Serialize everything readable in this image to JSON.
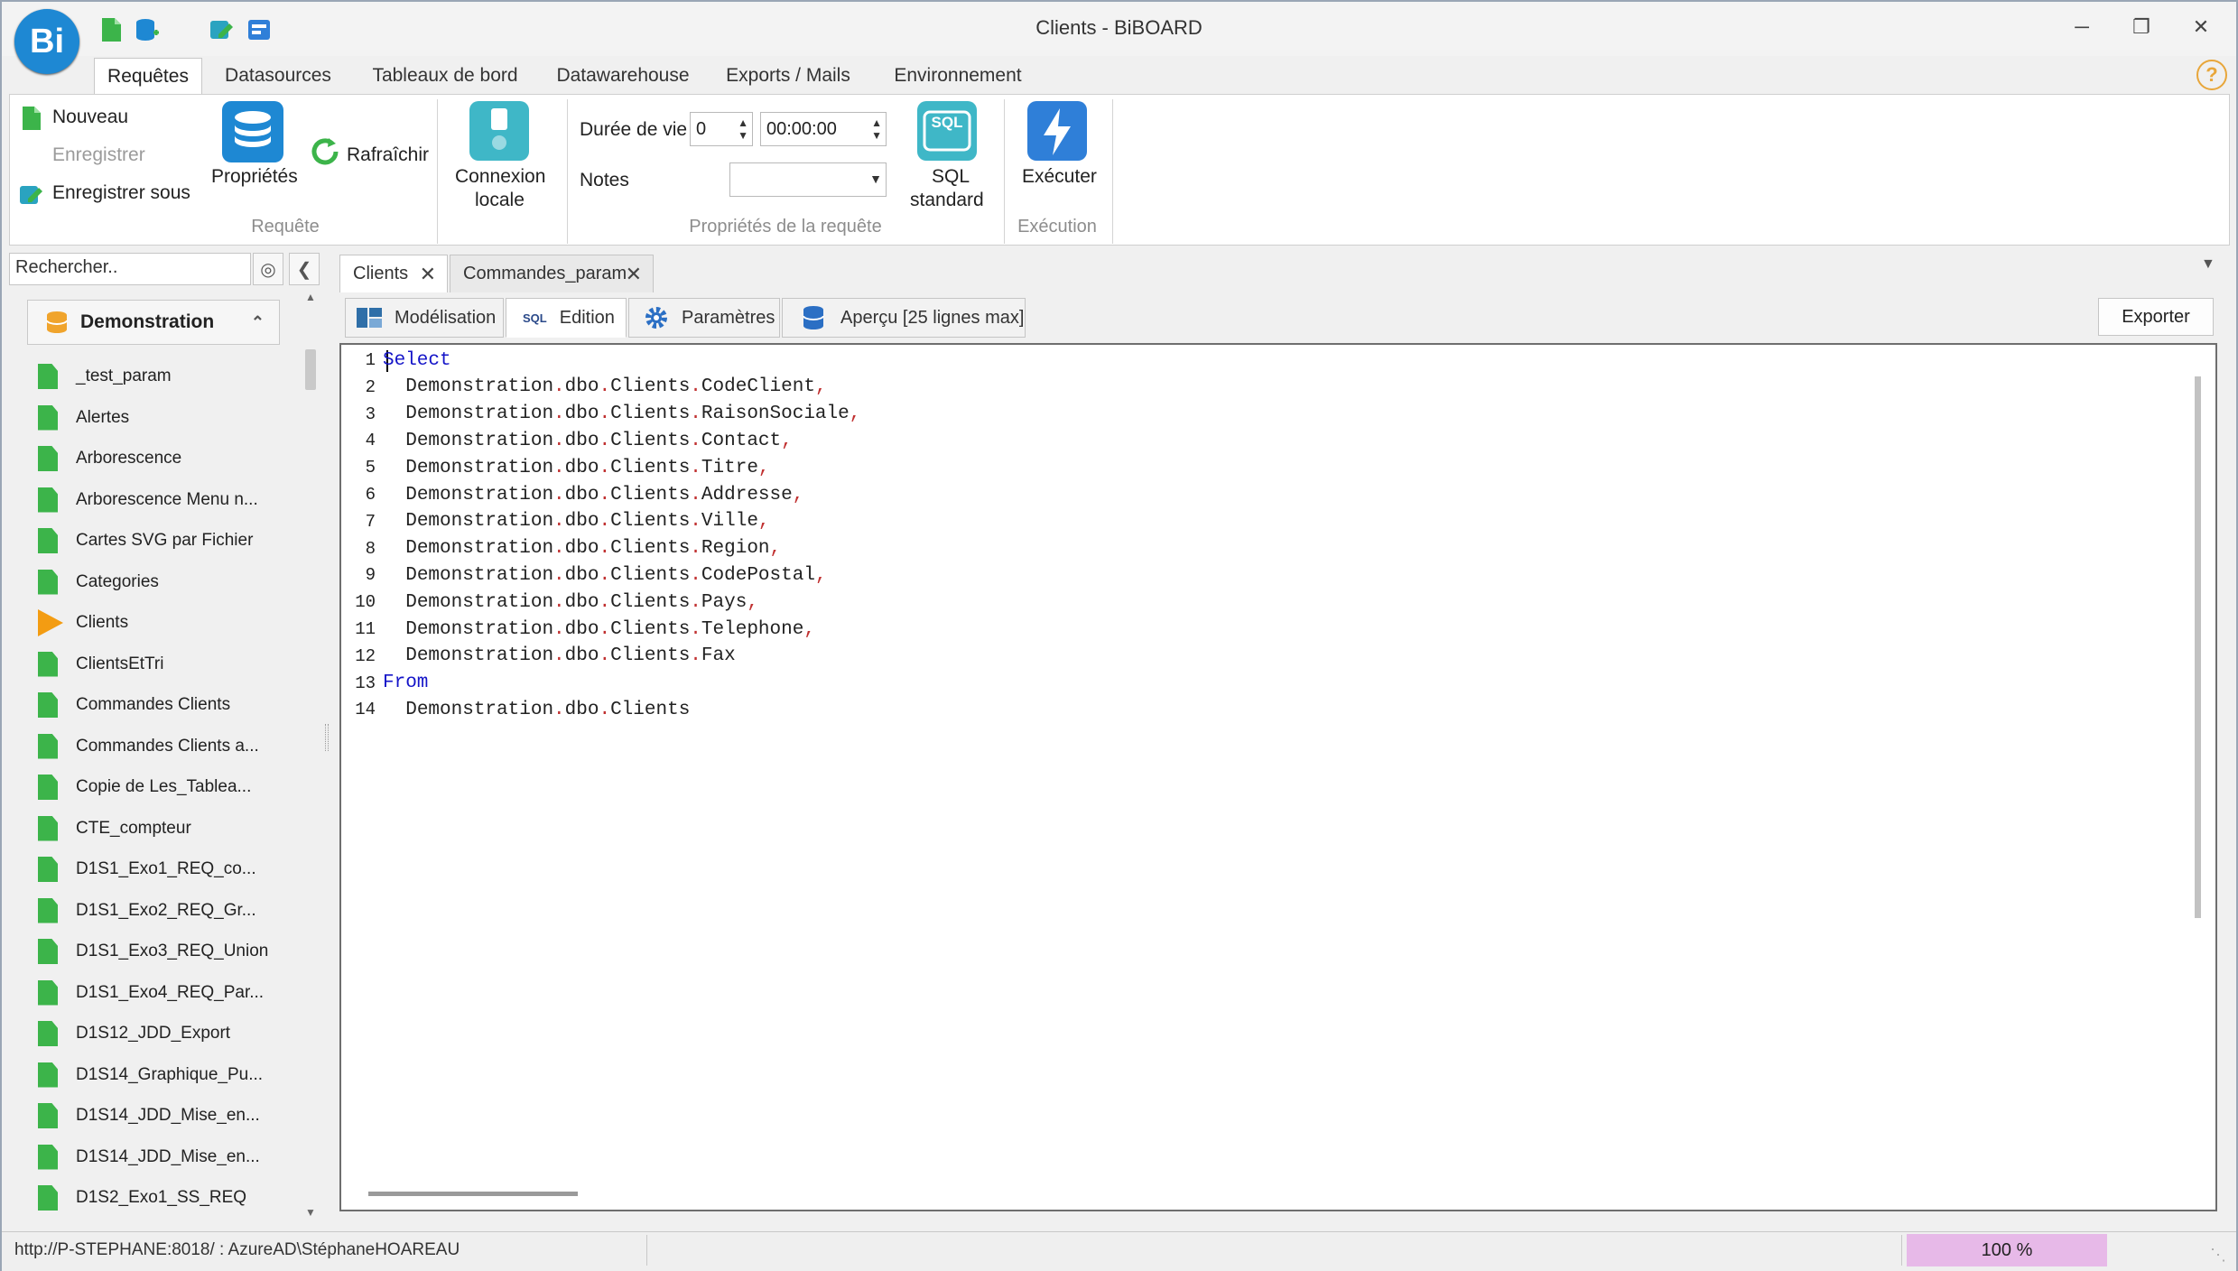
{
  "window": {
    "title": "Clients - BiBOARD",
    "logo_text": "Bi"
  },
  "menu_tabs": [
    "Requêtes",
    "Datasources",
    "Tableaux de bord",
    "Datawarehouse",
    "Exports / Mails",
    "Environnement"
  ],
  "ribbon": {
    "nouveau": "Nouveau",
    "enregistrer": "Enregistrer",
    "enregistrer_sous": "Enregistrer sous",
    "proprietes": "Propriétés",
    "rafraichir": "Rafraîchir",
    "connexion_line1": "Connexion",
    "connexion_line2": "locale",
    "group_requete": "Requête",
    "duree_label": "Durée de vie",
    "duree_value": "0",
    "duree_time": "00:00:00",
    "notes_label": "Notes",
    "sql_badge": "SQL",
    "sql_line1": "SQL",
    "sql_line2": "standard",
    "group_proprietes": "Propriétés de la requête",
    "executer": "Exécuter",
    "group_execution": "Exécution"
  },
  "sidebar": {
    "search_placeholder": "Rechercher..",
    "datasource": "Demonstration",
    "items": [
      {
        "label": "_test_param",
        "icon": "file-icon"
      },
      {
        "label": "Alertes",
        "icon": "file-icon"
      },
      {
        "label": "Arborescence",
        "icon": "file-icon"
      },
      {
        "label": "Arborescence Menu n...",
        "icon": "file-icon"
      },
      {
        "label": "Cartes SVG par Fichier",
        "icon": "file-icon"
      },
      {
        "label": "Categories",
        "icon": "file-icon"
      },
      {
        "label": "Clients",
        "icon": "play-icon"
      },
      {
        "label": "ClientsEtTri",
        "icon": "file-icon"
      },
      {
        "label": "Commandes Clients",
        "icon": "file-icon"
      },
      {
        "label": "Commandes Clients a...",
        "icon": "file-icon"
      },
      {
        "label": "Copie de Les_Tablea...",
        "icon": "file-icon"
      },
      {
        "label": "CTE_compteur",
        "icon": "file-icon"
      },
      {
        "label": "D1S1_Exo1_REQ_co...",
        "icon": "file-icon"
      },
      {
        "label": "D1S1_Exo2_REQ_Gr...",
        "icon": "file-icon"
      },
      {
        "label": "D1S1_Exo3_REQ_Union",
        "icon": "file-icon"
      },
      {
        "label": "D1S1_Exo4_REQ_Par...",
        "icon": "file-icon"
      },
      {
        "label": "D1S12_JDD_Export",
        "icon": "file-icon"
      },
      {
        "label": "D1S14_Graphique_Pu...",
        "icon": "file-icon"
      },
      {
        "label": "D1S14_JDD_Mise_en...",
        "icon": "file-icon"
      },
      {
        "label": "D1S14_JDD_Mise_en...",
        "icon": "file-icon"
      },
      {
        "label": "D1S2_Exo1_SS_REQ",
        "icon": "file-icon"
      }
    ]
  },
  "doc_tabs": [
    "Clients",
    "Commandes_param"
  ],
  "inner_tabs": {
    "modelisation": "Modélisation",
    "sql_prefix": "SQL",
    "edition": "Edition",
    "parametres": "Paramètres",
    "apercu": "Aperçu [25 lignes max]",
    "exporter": "Exporter"
  },
  "editor": {
    "lines": [
      {
        "no": "1",
        "kw": "Select",
        "parts": []
      },
      {
        "no": "2",
        "kw": "",
        "parts": [
          "Demonstration",
          "dbo",
          "Clients",
          "CodeClient"
        ],
        "comma": true
      },
      {
        "no": "3",
        "kw": "",
        "parts": [
          "Demonstration",
          "dbo",
          "Clients",
          "RaisonSociale"
        ],
        "comma": true
      },
      {
        "no": "4",
        "kw": "",
        "parts": [
          "Demonstration",
          "dbo",
          "Clients",
          "Contact"
        ],
        "comma": true
      },
      {
        "no": "5",
        "kw": "",
        "parts": [
          "Demonstration",
          "dbo",
          "Clients",
          "Titre"
        ],
        "comma": true
      },
      {
        "no": "6",
        "kw": "",
        "parts": [
          "Demonstration",
          "dbo",
          "Clients",
          "Addresse"
        ],
        "comma": true
      },
      {
        "no": "7",
        "kw": "",
        "parts": [
          "Demonstration",
          "dbo",
          "Clients",
          "Ville"
        ],
        "comma": true
      },
      {
        "no": "8",
        "kw": "",
        "parts": [
          "Demonstration",
          "dbo",
          "Clients",
          "Region"
        ],
        "comma": true
      },
      {
        "no": "9",
        "kw": "",
        "parts": [
          "Demonstration",
          "dbo",
          "Clients",
          "CodePostal"
        ],
        "comma": true
      },
      {
        "no": "10",
        "kw": "",
        "parts": [
          "Demonstration",
          "dbo",
          "Clients",
          "Pays"
        ],
        "comma": true
      },
      {
        "no": "11",
        "kw": "",
        "parts": [
          "Demonstration",
          "dbo",
          "Clients",
          "Telephone"
        ],
        "comma": true
      },
      {
        "no": "12",
        "kw": "",
        "parts": [
          "Demonstration",
          "dbo",
          "Clients",
          "Fax"
        ],
        "comma": false
      },
      {
        "no": "13",
        "kw": "From",
        "parts": []
      },
      {
        "no": "14",
        "kw": "",
        "parts": [
          "Demonstration",
          "dbo",
          "Clients"
        ],
        "comma": false
      }
    ]
  },
  "status": {
    "url": "http://P-STEPHANE:8018/ : AzureAD\\StéphaneHOAREAU",
    "zoom": "100 %"
  },
  "colors": {
    "accent": "#1e88d3",
    "file_icon": "#3cb44a",
    "active_icon": "#f39c12",
    "keyword": "#1414c8",
    "punct": "#c03030",
    "zoom_bg": "#e7b9e8"
  }
}
